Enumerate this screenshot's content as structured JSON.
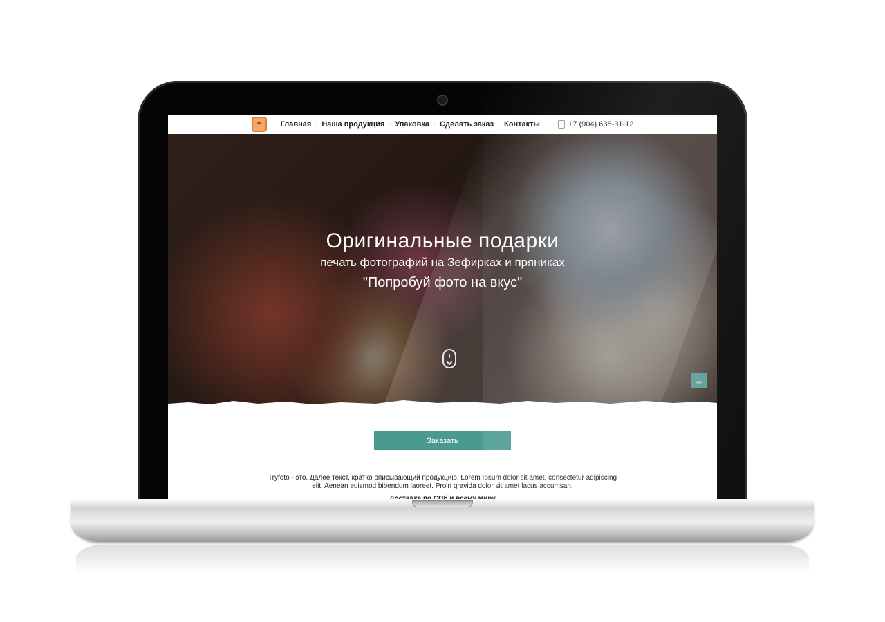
{
  "nav": {
    "items": [
      "Главная",
      "Наша продукция",
      "Упаковка",
      "Сделать заказ",
      "Контакты"
    ],
    "phone": "+7 (904) 638-31-12",
    "logo_icon": "heart-icon"
  },
  "hero": {
    "title": "Оригинальные подарки",
    "subtitle": "печать фотографий на Зефирках и пряниках",
    "quote": "\"Попробуй фото на вкус\""
  },
  "main": {
    "order_button": "Заказать",
    "intro_text": "Tryfoto - это. Далее текст, кратко описывающий продукцию. Lorem Ipsum dolor sit amet, consectetur adipiscing elit. Aenean euismod bibendum laoreet. Proin gravida dolor sit amet lacus accumsan.",
    "delivery_text": "Доставка по СПб и всему миру"
  },
  "colors": {
    "accent": "#4a9a92",
    "up_button": "#5ea7a1",
    "logo": "#f0a96b"
  }
}
